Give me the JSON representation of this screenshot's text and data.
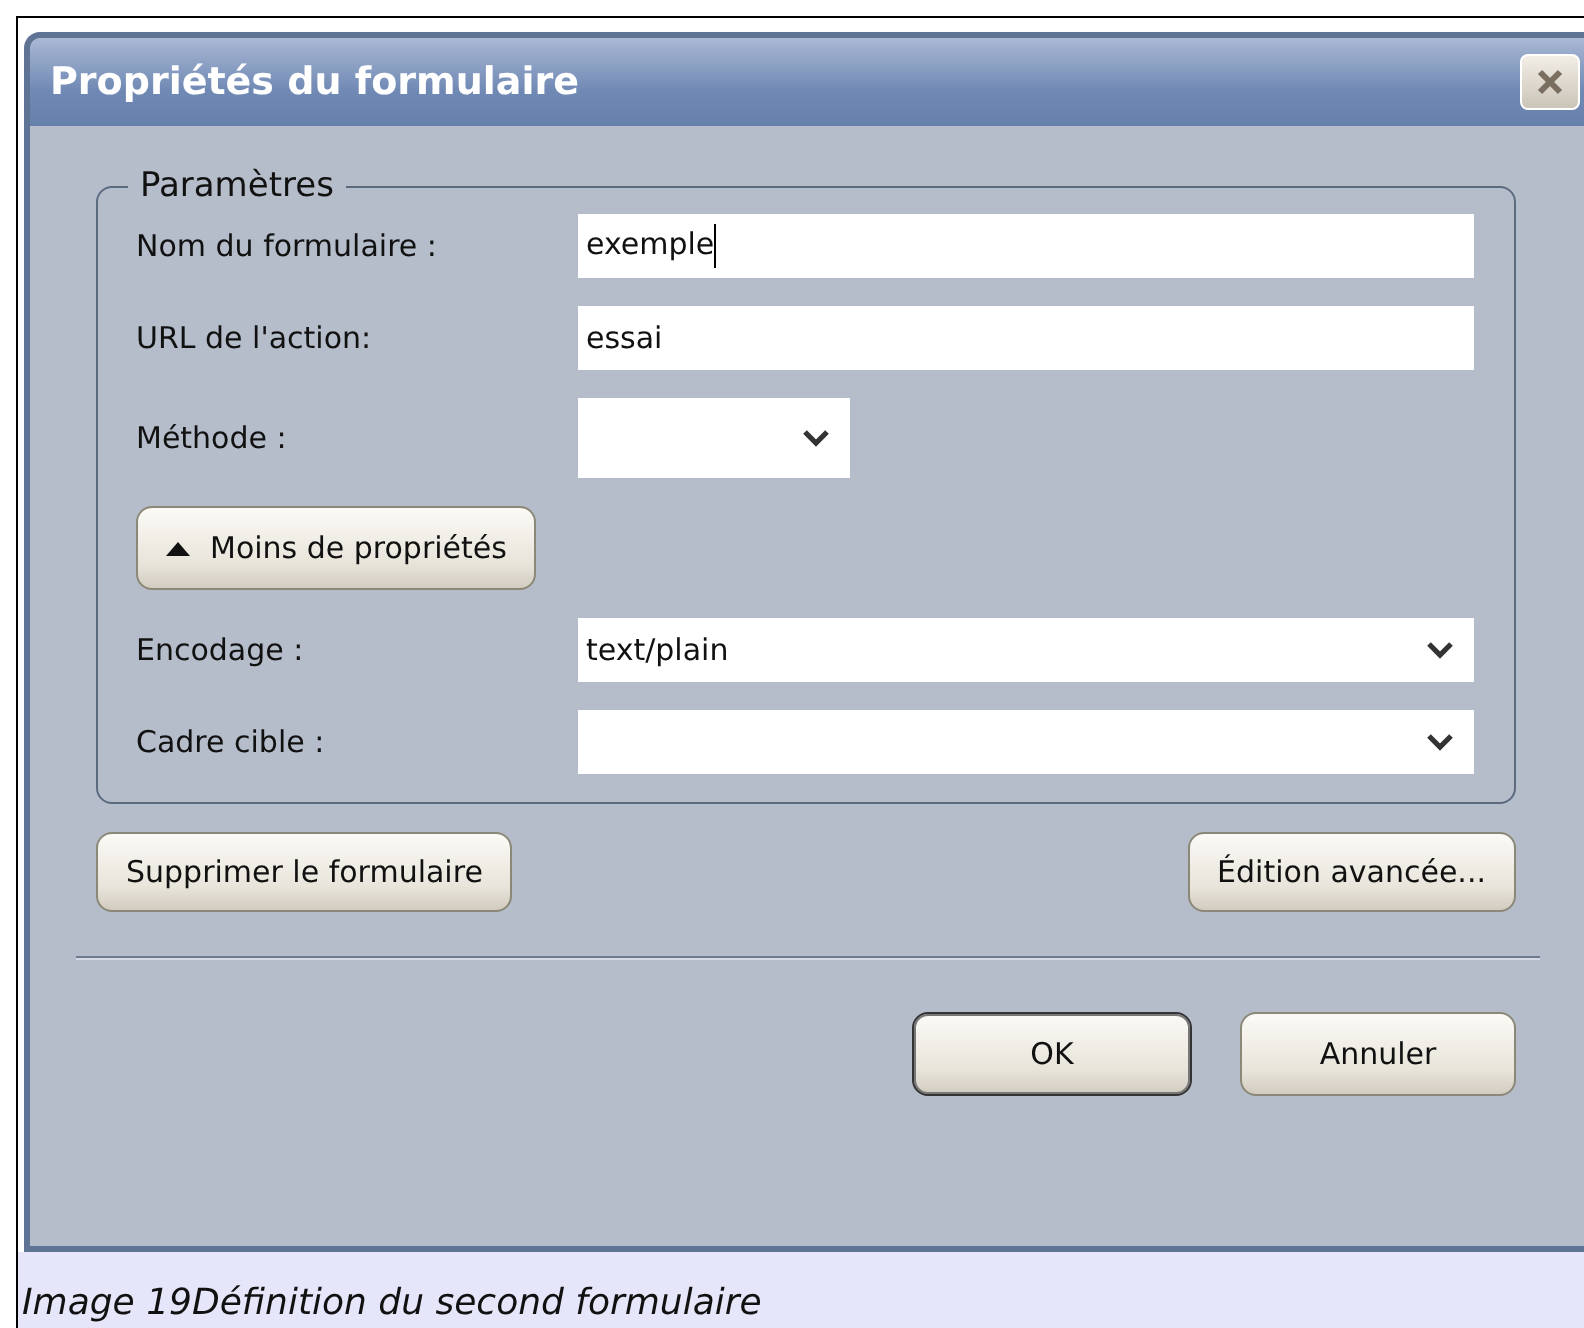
{
  "window": {
    "title": "Propriétés du formulaire"
  },
  "group": {
    "title": "Paramètres"
  },
  "fields": [
    {
      "kind": "text",
      "label": "Nom du formulaire :",
      "value": "exemple",
      "focused": true
    },
    {
      "kind": "text",
      "label": "URL de l'action:",
      "value": "essai",
      "focused": false
    },
    {
      "kind": "short-select",
      "label": "Méthode :"
    }
  ],
  "toggle_button": {
    "label": "Moins de propriétés",
    "expanded": true
  },
  "extra_fields": [
    {
      "kind": "select",
      "label": "Encodage :",
      "value": "text/plain"
    },
    {
      "kind": "select",
      "label": "Cadre cible :"
    }
  ],
  "action_buttons": [
    "Supprimer le formulaire",
    "Édition avancée..."
  ],
  "buttons": [
    {
      "label": "OK",
      "default": true
    },
    {
      "label": "Annuler",
      "default": false
    }
  ],
  "caption": "Image 19Définition du second formulaire"
}
